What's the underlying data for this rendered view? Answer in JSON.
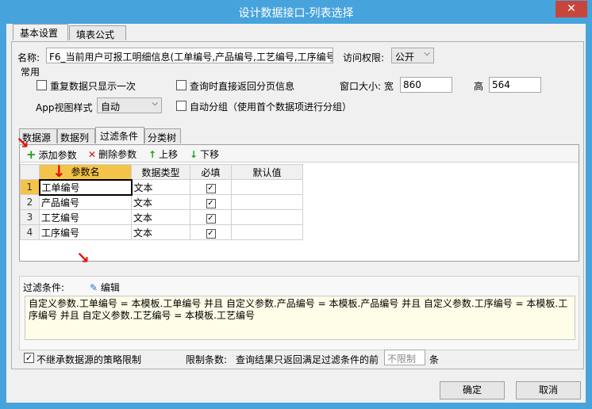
{
  "window": {
    "title": "设计数据接口-列表选择",
    "close_icon": "✕"
  },
  "tabs": [
    {
      "label": "基本设置"
    },
    {
      "label": "填表公式"
    }
  ],
  "form": {
    "name_label": "名称:",
    "name_value": "F6_当前用户可报工明细信息(工单编号,产品编号,工艺编号,工序编号",
    "access_label": "访问权限:",
    "access_value": "公开",
    "group_label": "常用",
    "cb_repeat": "重复数据只显示一次",
    "cb_paging": "查询时直接返回分页信息",
    "window_size_label": "窗口大小: 宽",
    "width_value": "860",
    "height_label": "高",
    "height_value": "564",
    "app_view_label": "App视图样式",
    "app_view_value": "自动",
    "cb_autogroup": "自动分组（使用首个数据项进行分组）"
  },
  "subtabs": [
    {
      "label": "数据源"
    },
    {
      "label": "数据列"
    },
    {
      "label": "过滤条件"
    },
    {
      "label": "分类树"
    }
  ],
  "toolbar": {
    "add": "添加参数",
    "delete": "删除参数",
    "up": "上移",
    "down": "下移"
  },
  "grid": {
    "headers": [
      "参数名",
      "数据类型",
      "必填",
      "默认值"
    ],
    "rows": [
      {
        "num": "1",
        "name": "工单编号",
        "type": "文本",
        "required": "✓",
        "default": ""
      },
      {
        "num": "2",
        "name": "产品编号",
        "type": "文本",
        "required": "✓",
        "default": ""
      },
      {
        "num": "3",
        "name": "工艺编号",
        "type": "文本",
        "required": "✓",
        "default": ""
      },
      {
        "num": "4",
        "name": "工序编号",
        "type": "文本",
        "required": "✓",
        "default": ""
      }
    ]
  },
  "filter": {
    "label": "过滤条件:",
    "edit": "编辑",
    "text": "自定义参数.工单编号 = 本模板.工单编号 并且 自定义参数.产品编号 = 本模板.产品编号 并且 自定义参数.工序编号 = 本模板.工序编号 并且 自定义参数.工艺编号 = 本模板.工艺编号"
  },
  "footer": {
    "cb_inherit": "不继承数据源的策略限制",
    "limit_label": "限制条数:",
    "limit_desc": "查询结果只返回满足过滤条件的前",
    "limit_placeholder": "不限制",
    "limit_unit": "条",
    "ok": "确定",
    "cancel": "取消"
  },
  "colors": {
    "titlebar": "#47a3dc",
    "close": "#c7463c",
    "selected": "#f4c34a",
    "filter_bg": "#fffde8"
  }
}
